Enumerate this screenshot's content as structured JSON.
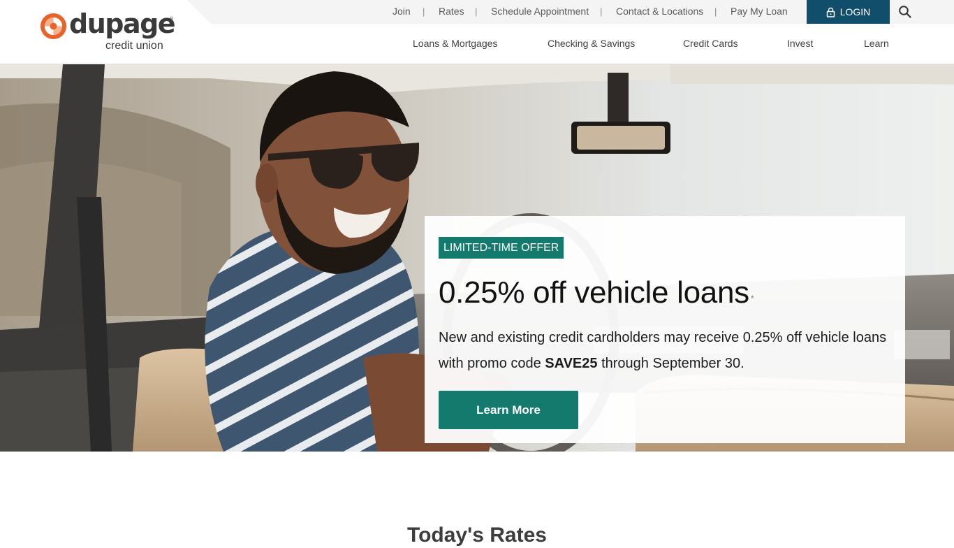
{
  "brand": {
    "name": "dupage",
    "subtitle": "credit union",
    "registered_mark": "®",
    "logo_icon": "dupage-swirl-logo",
    "colors": {
      "orange": "#e8622a",
      "navy": "#114e6b",
      "teal": "#157a6e",
      "text": "#3a3a3a"
    }
  },
  "utility_nav": {
    "items": [
      "Join",
      "Rates",
      "Schedule Appointment",
      "Contact & Locations",
      "Pay My Loan"
    ],
    "separator": "|",
    "login_label": "LOGIN",
    "login_icon": "lock-icon",
    "search_icon": "search-icon"
  },
  "main_nav": {
    "items": [
      "Loans & Mortgages",
      "Checking & Savings",
      "Credit Cards",
      "Invest",
      "Learn"
    ]
  },
  "hero": {
    "image": "smiling-man-in-sunglasses-driving-vintage-car",
    "badge": "LIMITED-TIME OFFER",
    "title": "0.25% off vehicle loans",
    "title_footnote": "*",
    "body_before": "New and existing credit cardholders may receive 0.25% off vehicle loans with promo code ",
    "promo_code": "SAVE25",
    "body_after": " through September 30.",
    "cta_label": "Learn More"
  },
  "rates_section": {
    "heading": "Today's Rates"
  }
}
